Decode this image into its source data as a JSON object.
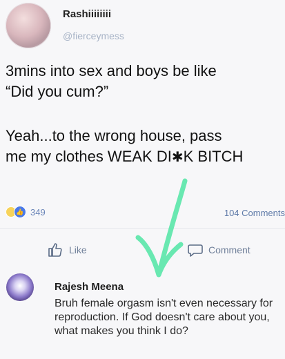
{
  "post": {
    "username": "Rashiiiiiiii",
    "handle": "@fierceymess",
    "lines": [
      "3mins into sex and boys be like",
      "“Did you cum?”",
      "Yeah...to the wrong house, pass",
      "me my clothes WEAK DI",
      "K BITCH"
    ],
    "censor_glyph": "✱"
  },
  "reactions": {
    "count": "349"
  },
  "comments_count": "104 Comments",
  "actions": {
    "like": "Like",
    "comment": "Comment"
  },
  "comment": {
    "name": "Rajesh Meena",
    "text": "Bruh female orgasm isn't even necessary for reproduction. If God doesn't care about you, what makes you think I do?"
  },
  "colors": {
    "arrow": "#59e6a8",
    "like_blue": "#4a79e8"
  }
}
